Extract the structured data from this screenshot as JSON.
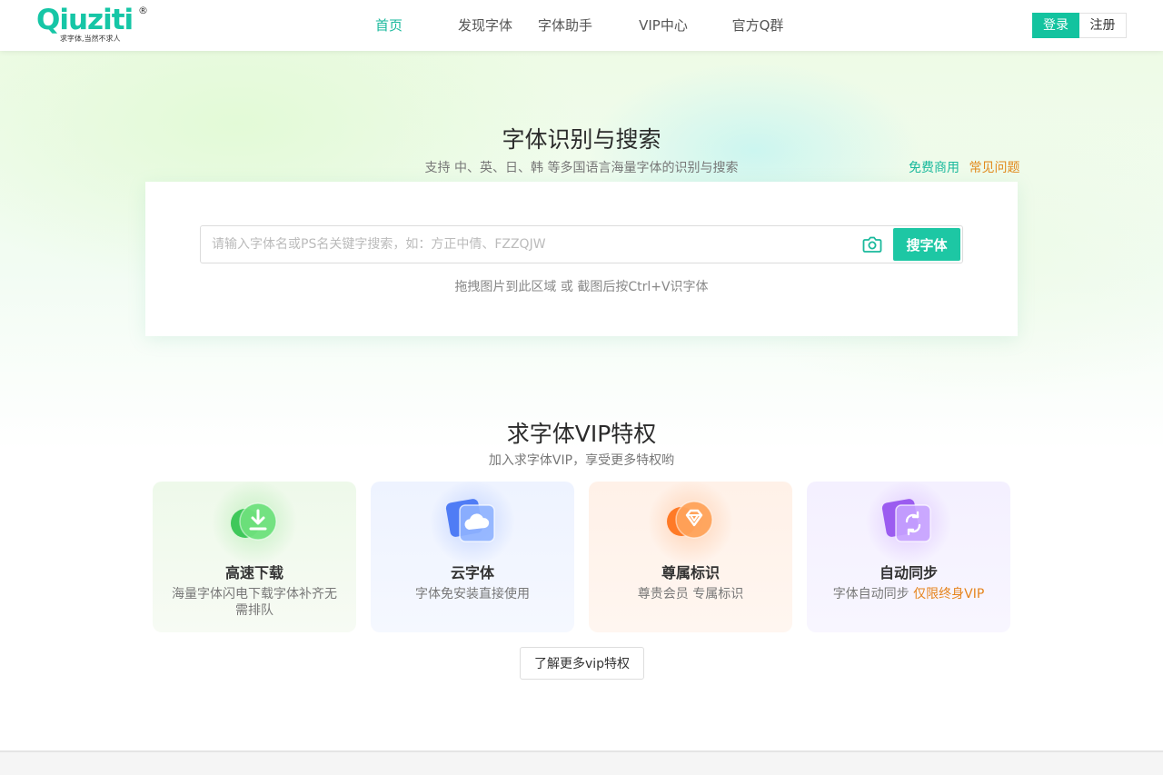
{
  "header": {
    "logo_text": "Qiuziti",
    "logo_reg": "®",
    "logo_slogan": "求字体,当然不求人",
    "nav": [
      {
        "label": "首页",
        "active": true
      },
      {
        "label": "发现字体",
        "active": false
      },
      {
        "label": "字体助手",
        "active": false
      },
      {
        "label": "VIP中心",
        "active": false
      },
      {
        "label": "官方Q群",
        "active": false
      }
    ],
    "login_label": "登录",
    "register_label": "注册"
  },
  "hero": {
    "title": "字体识别与搜索",
    "subtitle": "支持 中、英、日、韩 等多国语言海量字体的识别与搜索",
    "link_free": "免费商用",
    "link_faq": "常见问题"
  },
  "search": {
    "placeholder": "请输入字体名或PS名关键字搜索，如：方正中倩、FZZQJW",
    "value": "",
    "button_label": "搜字体",
    "camera_icon": "camera-icon",
    "drop_hint": "拖拽图片到此区域 或 截图后按Ctrl+V识字体"
  },
  "vip": {
    "title": "求字体VIP特权",
    "subtitle": "加入求字体VIP，享受更多特权哟",
    "cards": [
      {
        "title": "高速下载",
        "desc": "海量字体闪电下载字体补齐无需排队",
        "icon": "download-icon",
        "color": "#4cd46a"
      },
      {
        "title": "云字体",
        "desc": "字体免安装直接使用",
        "icon": "cloud-icon",
        "color": "#5a8cff"
      },
      {
        "title": "尊属标识",
        "desc": "尊贵会员 专属标识",
        "icon": "diamond-icon",
        "color": "#ff8a3d"
      },
      {
        "title": "自动同步",
        "desc": "字体自动同步 ",
        "highlight": "仅限终身VIP",
        "icon": "sync-icon",
        "color": "#a66cff"
      }
    ],
    "more_label": "了解更多vip特权"
  },
  "colors": {
    "accent": "#13c39f",
    "link_orange": "#e28a1d"
  }
}
